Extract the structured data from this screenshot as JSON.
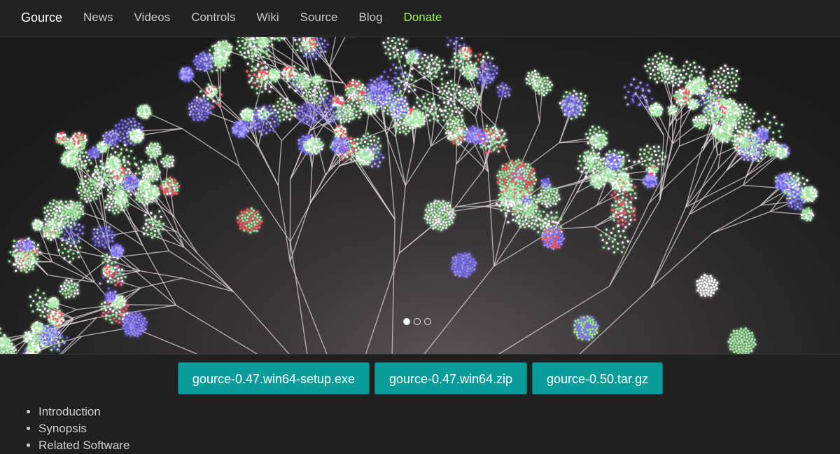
{
  "nav": {
    "brand": "Gource",
    "items": [
      {
        "label": "News"
      },
      {
        "label": "Videos"
      },
      {
        "label": "Controls"
      },
      {
        "label": "Wiki"
      },
      {
        "label": "Source"
      },
      {
        "label": "Blog"
      },
      {
        "label": "Donate"
      }
    ]
  },
  "carousel": {
    "slide_count": 3,
    "active_index": 0
  },
  "downloads": [
    {
      "label": "gource-0.47.win64-setup.exe"
    },
    {
      "label": "gource-0.47.win64.zip"
    },
    {
      "label": "gource-0.50.tar.gz"
    }
  ],
  "toc": [
    {
      "label": "Introduction"
    },
    {
      "label": "Synopsis"
    },
    {
      "label": "Related Software"
    }
  ],
  "colors": {
    "accent": "#0a9b9b",
    "donate": "#9cf04a",
    "background": "#202020"
  }
}
